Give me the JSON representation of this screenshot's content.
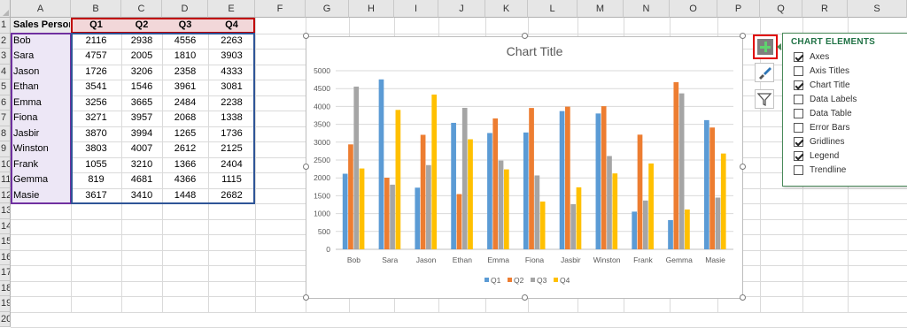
{
  "columns": [
    "A",
    "B",
    "C",
    "D",
    "E",
    "F",
    "G",
    "H",
    "I",
    "J",
    "K",
    "L",
    "M",
    "N",
    "O",
    "P",
    "Q",
    "R",
    "S"
  ],
  "rows": [
    "1",
    "2",
    "3",
    "4",
    "5",
    "6",
    "7",
    "8",
    "9",
    "10",
    "11",
    "12",
    "13",
    "14",
    "15",
    "16",
    "17",
    "18",
    "19",
    "20"
  ],
  "table": {
    "headers": [
      "Sales Person",
      "Q1",
      "Q2",
      "Q3",
      "Q4"
    ],
    "rows": [
      [
        "Bob",
        "2116",
        "2938",
        "4556",
        "2263"
      ],
      [
        "Sara",
        "4757",
        "2005",
        "1810",
        "3903"
      ],
      [
        "Jason",
        "1726",
        "3206",
        "2358",
        "4333"
      ],
      [
        "Ethan",
        "3541",
        "1546",
        "3961",
        "3081"
      ],
      [
        "Emma",
        "3256",
        "3665",
        "2484",
        "2238"
      ],
      [
        "Fiona",
        "3271",
        "3957",
        "2068",
        "1338"
      ],
      [
        "Jasbir",
        "3870",
        "3994",
        "1265",
        "1736"
      ],
      [
        "Winston",
        "3803",
        "4007",
        "2612",
        "2125"
      ],
      [
        "Frank",
        "1055",
        "3210",
        "1366",
        "2404"
      ],
      [
        "Gemma",
        "819",
        "4681",
        "4366",
        "1115"
      ],
      [
        "Masie",
        "3617",
        "3410",
        "1448",
        "2682"
      ]
    ]
  },
  "chart_data": {
    "type": "bar",
    "title": "Chart Title",
    "categories": [
      "Bob",
      "Sara",
      "Jason",
      "Ethan",
      "Emma",
      "Fiona",
      "Jasbir",
      "Winston",
      "Frank",
      "Gemma",
      "Masie"
    ],
    "series": [
      {
        "name": "Q1",
        "color": "#5B9BD5",
        "values": [
          2116,
          4757,
          1726,
          3541,
          3256,
          3271,
          3870,
          3803,
          1055,
          819,
          3617
        ]
      },
      {
        "name": "Q2",
        "color": "#ED7D31",
        "values": [
          2938,
          2005,
          3206,
          1546,
          3665,
          3957,
          3994,
          4007,
          3210,
          4681,
          3410
        ]
      },
      {
        "name": "Q3",
        "color": "#A5A5A5",
        "values": [
          4556,
          1810,
          2358,
          3961,
          2484,
          2068,
          1265,
          2612,
          1366,
          4366,
          1448
        ]
      },
      {
        "name": "Q4",
        "color": "#FFC000",
        "values": [
          2263,
          3903,
          4333,
          3081,
          2238,
          1338,
          1736,
          2125,
          2404,
          1115,
          2682
        ]
      }
    ],
    "ylim": [
      0,
      5000
    ],
    "yticks": [
      "0",
      "500",
      "1000",
      "1500",
      "2000",
      "2500",
      "3000",
      "3500",
      "4000",
      "4500",
      "5000"
    ],
    "grid": true,
    "legend": "bottom"
  },
  "side_buttons": {
    "add": "plus-icon",
    "style": "brush-icon",
    "filter": "filter-icon"
  },
  "panel": {
    "title": "CHART ELEMENTS",
    "items": [
      {
        "label": "Axes",
        "checked": true
      },
      {
        "label": "Axis Titles",
        "checked": false
      },
      {
        "label": "Chart Title",
        "checked": true
      },
      {
        "label": "Data Labels",
        "checked": false
      },
      {
        "label": "Data Table",
        "checked": false
      },
      {
        "label": "Error Bars",
        "checked": false
      },
      {
        "label": "Gridlines",
        "checked": true
      },
      {
        "label": "Legend",
        "checked": true
      },
      {
        "label": "Trendline",
        "checked": false
      }
    ]
  },
  "colors": {
    "header_fill": "#f2d7d9",
    "name_fill": "#ede7f6",
    "selection_blue": "#2f5597",
    "selection_purple": "#7030a0",
    "selection_red": "#c00000",
    "accent_green": "#217346"
  }
}
